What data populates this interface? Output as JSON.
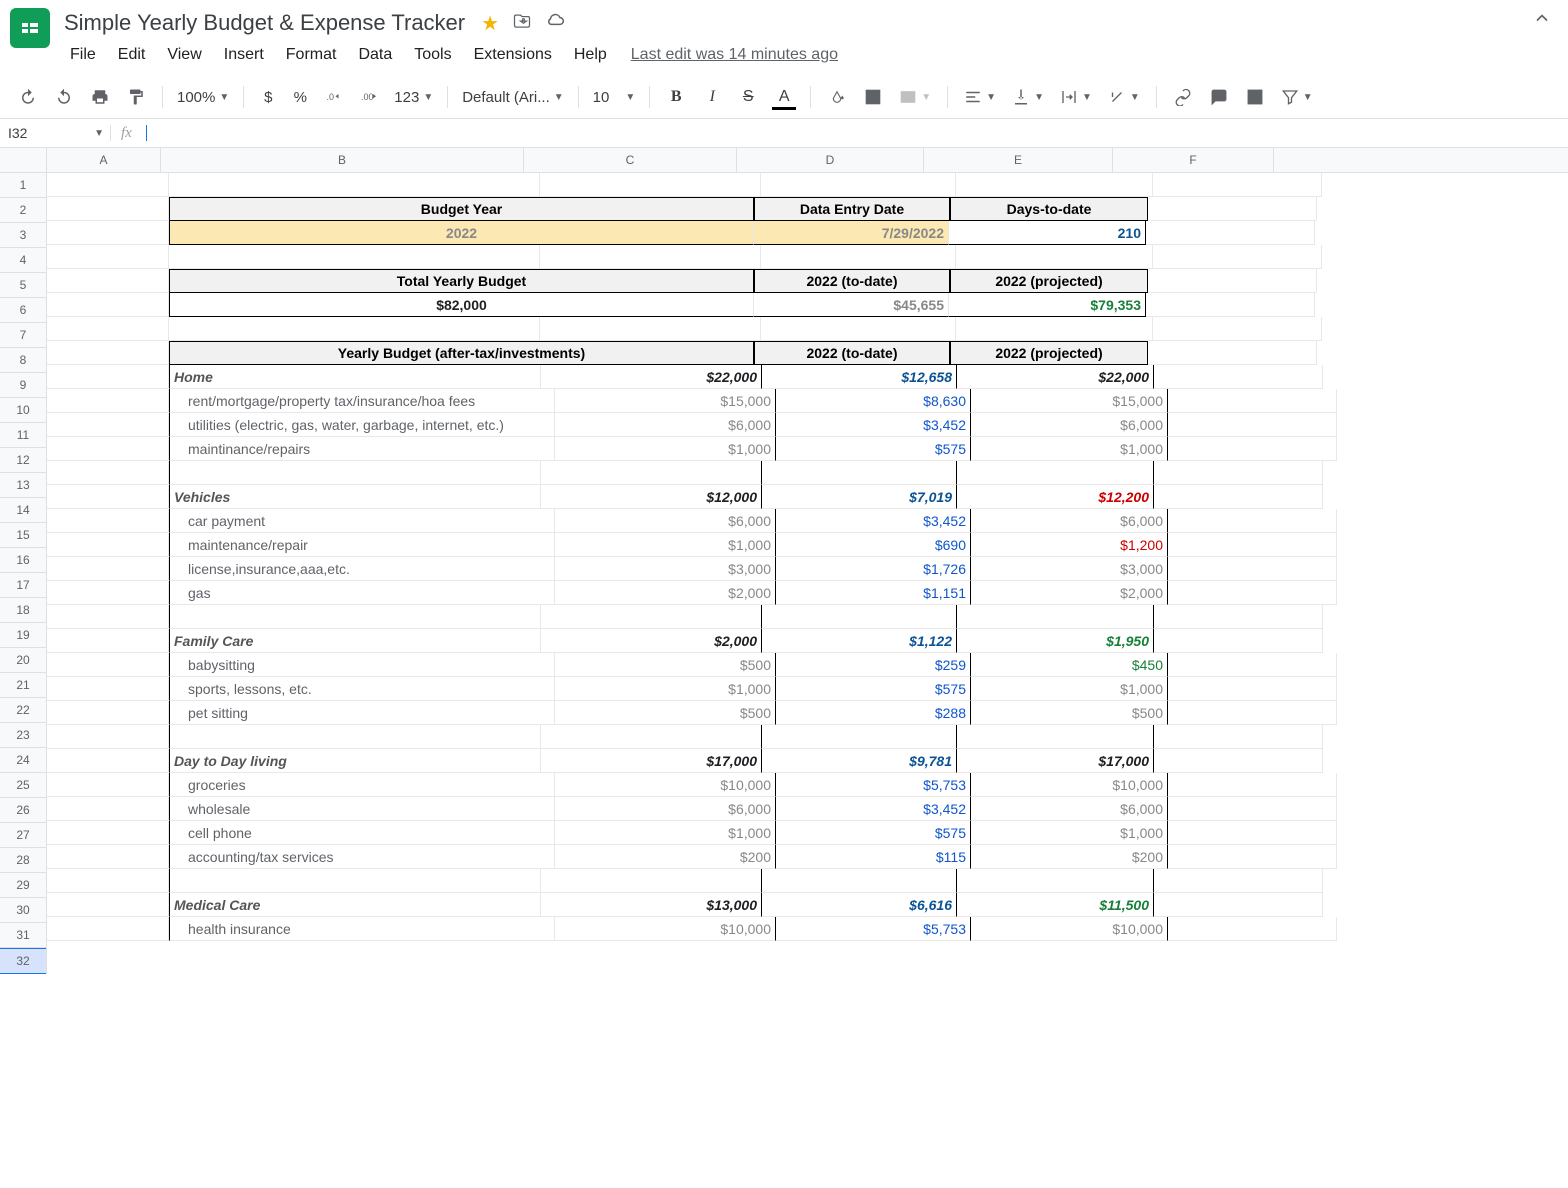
{
  "doc": {
    "title": "Simple Yearly Budget & Expense Tracker",
    "last_edit": "Last edit was 14 minutes ago"
  },
  "menu": {
    "file": "File",
    "edit": "Edit",
    "view": "View",
    "insert": "Insert",
    "format": "Format",
    "data": "Data",
    "tools": "Tools",
    "extensions": "Extensions",
    "help": "Help"
  },
  "toolbar": {
    "zoom": "100%",
    "currency": "$",
    "percent": "%",
    "fmt123": "123",
    "font": "Default (Ari...",
    "fontsize": "10"
  },
  "namebox": "I32",
  "cols": [
    "A",
    "B",
    "C",
    "D",
    "E",
    "F"
  ],
  "rownums": [
    "1",
    "2",
    "3",
    "4",
    "5",
    "6",
    "7",
    "8",
    "9",
    "10",
    "11",
    "12",
    "13",
    "14",
    "15",
    "16",
    "17",
    "18",
    "19",
    "20",
    "21",
    "22",
    "23",
    "24",
    "25",
    "26",
    "27",
    "28",
    "29",
    "30",
    "31",
    "32"
  ],
  "s": {
    "r2": {
      "by": "Budget Year",
      "ded": "Data Entry Date",
      "dtd": "Days-to-date"
    },
    "r3": {
      "by": "2022",
      "ded": "7/29/2022",
      "dtd": "210"
    },
    "r5": {
      "tyb": "Total Yearly Budget",
      "td": "2022 (to-date)",
      "pj": "2022 (projected)"
    },
    "r6": {
      "tyb": "$82,000",
      "td": "$45,655",
      "pj": "$79,353"
    },
    "r8": {
      "yb": "Yearly Budget (after-tax/investments)",
      "td": "2022 (to-date)",
      "pj": "2022 (projected)"
    },
    "r9": {
      "b": "Home",
      "c": "$22,000",
      "d": "$12,658",
      "e": "$22,000"
    },
    "r10": {
      "b": "rent/mortgage/property tax/insurance/hoa fees",
      "c": "$15,000",
      "d": "$8,630",
      "e": "$15,000"
    },
    "r11": {
      "b": "utilities (electric, gas, water, garbage, internet, etc.)",
      "c": "$6,000",
      "d": "$3,452",
      "e": "$6,000"
    },
    "r12": {
      "b": "maintinance/repairs",
      "c": "$1,000",
      "d": "$575",
      "e": "$1,000"
    },
    "r14": {
      "b": "Vehicles",
      "c": "$12,000",
      "d": "$7,019",
      "e": "$12,200"
    },
    "r15": {
      "b": "car payment",
      "c": "$6,000",
      "d": "$3,452",
      "e": "$6,000"
    },
    "r16": {
      "b": "maintenance/repair",
      "c": "$1,000",
      "d": "$690",
      "e": "$1,200"
    },
    "r17": {
      "b": "license,insurance,aaa,etc.",
      "c": "$3,000",
      "d": "$1,726",
      "e": "$3,000"
    },
    "r18": {
      "b": "gas",
      "c": "$2,000",
      "d": "$1,151",
      "e": "$2,000"
    },
    "r20": {
      "b": "Family Care",
      "c": "$2,000",
      "d": "$1,122",
      "e": "$1,950"
    },
    "r21": {
      "b": "babysitting",
      "c": "$500",
      "d": "$259",
      "e": "$450"
    },
    "r22": {
      "b": "sports, lessons, etc.",
      "c": "$1,000",
      "d": "$575",
      "e": "$1,000"
    },
    "r23": {
      "b": "pet sitting",
      "c": "$500",
      "d": "$288",
      "e": "$500"
    },
    "r25": {
      "b": "Day to Day living",
      "c": "$17,000",
      "d": "$9,781",
      "e": "$17,000"
    },
    "r26": {
      "b": "groceries",
      "c": "$10,000",
      "d": "$5,753",
      "e": "$10,000"
    },
    "r27": {
      "b": "wholesale",
      "c": "$6,000",
      "d": "$3,452",
      "e": "$6,000"
    },
    "r28": {
      "b": "cell phone",
      "c": "$1,000",
      "d": "$575",
      "e": "$1,000"
    },
    "r29": {
      "b": "accounting/tax services",
      "c": "$200",
      "d": "$115",
      "e": "$200"
    },
    "r31": {
      "b": "Medical Care",
      "c": "$13,000",
      "d": "$6,616",
      "e": "$11,500"
    },
    "r32": {
      "b": "health insurance",
      "c": "$10,000",
      "d": "$5,753",
      "e": "$10,000"
    }
  }
}
